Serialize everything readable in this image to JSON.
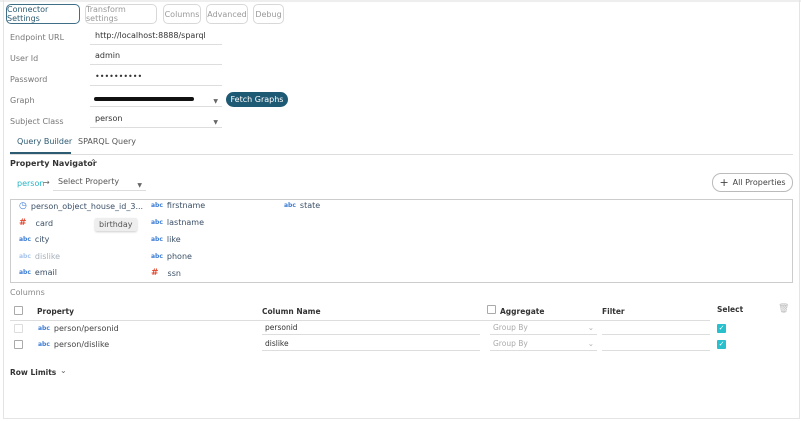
{
  "tabs": [
    "Connector Settings",
    "Transform settings",
    "Columns",
    "Advanced",
    "Debug"
  ],
  "form": {
    "endpoint_label": "Endpoint URL",
    "endpoint_value": "http://localhost:8888/sparql",
    "user_label": "User Id",
    "user_value": "admin",
    "password_label": "Password",
    "password_value": "••••••••••",
    "graph_label": "Graph",
    "subject_label": "Subject Class",
    "subject_value": "person",
    "fetch_label": "Fetch Graphs"
  },
  "subtabs": [
    "Query Builder",
    "SPARQL Query"
  ],
  "navigator": {
    "title": "Property Navigator",
    "root": "person",
    "arrow": "→",
    "select_placeholder": "Select Property",
    "all_properties": "All Properties",
    "plus": "+",
    "tooltip": "birthday",
    "properties": [
      {
        "type": "clock",
        "name": "person_object_house_id_3..."
      },
      {
        "type": "#",
        "name": "card"
      },
      {
        "type": "abc",
        "name": "city"
      },
      {
        "type": "abc",
        "name": "dislike"
      },
      {
        "type": "abc",
        "name": "email"
      },
      {
        "type": "abc",
        "name": "firstname"
      },
      {
        "type": "abc",
        "name": "lastname"
      },
      {
        "type": "abc",
        "name": "like"
      },
      {
        "type": "abc",
        "name": "phone"
      },
      {
        "type": "#",
        "name": "ssn"
      },
      {
        "type": "abc",
        "name": "state"
      }
    ]
  },
  "columns": {
    "title": "Columns",
    "headers": {
      "property": "Property",
      "column_name": "Column Name",
      "aggregate": "Aggregate",
      "filter": "Filter",
      "select": "Select"
    },
    "rows": [
      {
        "type": "abc",
        "property": "person/personid",
        "column_name": "personid",
        "aggregate": "Group By",
        "filter": "",
        "selected": true
      },
      {
        "type": "abc",
        "property": "person/dislike",
        "column_name": "dislike",
        "aggregate": "Group By",
        "filter": "",
        "selected": true
      }
    ]
  },
  "row_limits": "Row Limits",
  "colors": {
    "accent": "#1f5a74",
    "check": "#27c0cc",
    "person": "#27b5c5"
  }
}
